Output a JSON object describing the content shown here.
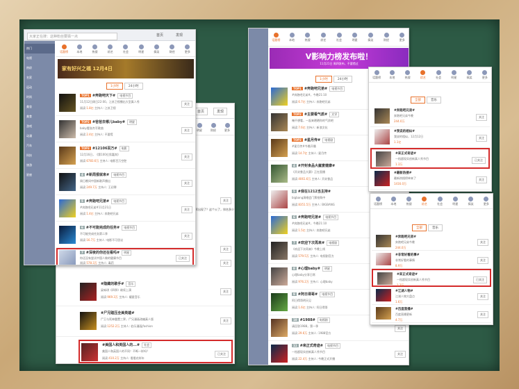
{
  "shot1": {
    "search_placeholder": "大家正在搜：这种粉丝要猜一点",
    "home": "首页",
    "discover": "发现",
    "side": [
      "热门",
      "电视",
      "热综",
      "名家",
      "运动",
      "时尚",
      "美妆",
      "美食",
      "游戏",
      "动漫",
      "汽车",
      "科技",
      "旅游",
      "星座"
    ],
    "icons": [
      "话题榜",
      "本地",
      "热搜",
      "综艺",
      "社会",
      "明星",
      "搞笑",
      "财经",
      "更多"
    ],
    "banner": "家有好兴之福 12月4日",
    "tabs": [
      "1小时",
      "24小时"
    ],
    "rows": [
      {
        "rank": "TOP1",
        "title": "#奔跑吧天下#",
        "tag": "电视节目",
        "desc": "11月12日周日22:00，江苏卫视播出大型真人秀",
        "read": "阅读:",
        "num": "1.8亿",
        "host": "主持人: 江苏卫视"
      },
      {
        "rank": "TOP2",
        "title": "#爸爸去哪儿baby#",
        "tag": "明星",
        "desc": "baby看张杰写歌曲",
        "read": "阅读:",
        "num": "2.4亿",
        "host": "主持人: 不要慌"
      },
      {
        "rank": "TOP3",
        "title": "#12106百万#",
        "tag": "电影",
        "desc": "12月16日，《第100位男嘉宾》",
        "read": "阅读:",
        "num": "6783.6万",
        "host": "主持人: 电影百万空腔"
      },
      {
        "rank": "4",
        "title": "#新周报就来#",
        "tag": "电视节目",
        "desc": "周日晚间中国新歌声播出",
        "read": "阅读:",
        "num": "249.7万",
        "host": "主持人: 王初寒"
      },
      {
        "rank": "5",
        "title": "#奔跑吧兄弟#",
        "tag": "电视节目",
        "desc": "#奔跑吧兄弟#11月21日",
        "read": "阅读:",
        "num": "1.4亿",
        "host": "主持人: 奔跑吧兄弟"
      },
      {
        "rank": "6",
        "title": "#不可能完成的任务#",
        "tag": "电视节目",
        "desc": "不可能完成任务第二季",
        "read": "阅读:",
        "num": "16.7万",
        "host": "主持人: 电影不可思议"
      },
      {
        "rank": "7",
        "title": "#深夜的你还在看吗#",
        "tag": "明星",
        "desc": "你还没有尝试中国人做的健康节目",
        "read": "阅读:",
        "num": "578.3万",
        "host": "主持人: 毒药"
      }
    ],
    "follow": "关注",
    "followed": "已关注"
  },
  "shot2": {
    "home": "首页",
    "discover": "发现",
    "icons": [
      "话题榜",
      "本地",
      "热搜",
      "综艺",
      "社会",
      "明星",
      "搞笑",
      "财经",
      "更多"
    ],
    "line": "冠军出现了？这个火了，排名多少",
    "rows": [
      {
        "title": "#隐藏的歌手#",
        "tag": "音乐",
        "desc": "梁咏琪《四季》继续上演",
        "read": "阅读:",
        "num": "969.3万",
        "host": "主持人: 耀星音乐"
      },
      {
        "title": "#尸兄碰压全美英雄#",
        "tag": "",
        "desc": "尸王与死神重置三界，尸兄漫画改编真人版",
        "read": "阅读:",
        "num": "1252.2万",
        "host": "主持人: 伯乐漫画jfashion"
      },
      {
        "title": "#美国人和英国人的...#",
        "tag": "社会",
        "desc": "美国人和英国人的不同！不断一样吗？",
        "read": "阅读:",
        "num": "410.2万",
        "host": "主持人: 看看花样年"
      }
    ]
  },
  "shot3": {
    "banner": "V影响力榜发布啦！",
    "banner_sub": "11月21日 周四发布，不要错过",
    "icons": [
      "话题榜",
      "本地",
      "热搜",
      "综艺",
      "社会",
      "明星",
      "搞笑",
      "财经",
      "更多"
    ],
    "tabs": [
      "1小时",
      "24小时"
    ],
    "rows": [
      {
        "rank": "TOP1",
        "title": "#奔跑吧兄弟#",
        "tag": "电视节目",
        "desc": "#奔跑吧兄弟#，今晚21:10",
        "read": "阅读:",
        "num": "6.7亿",
        "host": "主持人: 奔跑吧兄弟"
      },
      {
        "rank": "TOP2",
        "title": "#主要看气质#",
        "tag": "文学",
        "desc": "俺不想看，一起来晒晒你的气质吧",
        "read": "阅读:",
        "num": "7.6亿",
        "host": "主持人: 新浪文化"
      },
      {
        "rank": "TOP3",
        "title": "#星月传#",
        "tag": "电视剧",
        "desc": "#星月传#今晚开播",
        "read": "阅读:",
        "num": "14.7亿",
        "host": "主持人: 星月传"
      },
      {
        "rank": "4",
        "title": "#开封食品大酱宴健康#",
        "tag": "",
        "desc": "《开封食品大赛》正在直播",
        "read": "阅读:",
        "num": "4061.6万",
        "host": "主持人: 开封食品"
      },
      {
        "rank": "5",
        "title": "#我在1212当主持#",
        "tag": "",
        "desc": "bigbang演唱会门票抢购中",
        "read": "阅读:",
        "num": "8351.5万",
        "host": "主持人: BIGBANG"
      },
      {
        "rank": "6",
        "title": "#奔跑吧兄弟#",
        "tag": "电视节目",
        "desc": "#奔跑吧兄弟#，今晚21:10",
        "read": "阅读:",
        "num": "1.5亿",
        "host": "主持人: 奔跑吧兄弟"
      },
      {
        "rank": "7",
        "title": "#欢迎下次再来#",
        "tag": "电视剧",
        "desc": "《欢迎下次再来》今晚上线",
        "read": "阅读:",
        "num": "579.5万",
        "host": "主持人: 电视剧官方"
      },
      {
        "rank": "8",
        "title": "#心理baby#",
        "tag": "明星",
        "desc": "心理baby分享日常",
        "read": "阅读:",
        "num": "976.2万",
        "host": "主持人: 心理baby"
      },
      {
        "rank": "9",
        "title": "#阿日得哥#",
        "tag": "电视节目",
        "desc": "阿日得哥明天见",
        "read": "阅读:",
        "num": "1.6亿",
        "host": "主持人: 阿日得哥"
      },
      {
        "rank": "10",
        "title": "#1988#",
        "tag": "电视剧",
        "desc": "请回答1988，第一季",
        "read": "阅读:",
        "num": "29.6万",
        "host": "主持人: 1988官方"
      },
      {
        "rank": "11",
        "title": "#来正式奇迹#",
        "tag": "电视节目",
        "desc": "一档超现实创新真人秀节目",
        "read": "阅读:",
        "num": "22.4万",
        "host": "主持人: 今晚正式开播"
      }
    ],
    "follow": "关注"
  },
  "shot4": {
    "icons": [
      "话题榜",
      "本地",
      "热搜",
      "综艺",
      "社会",
      "明星",
      "搞笑",
      "更多"
    ],
    "tabs": [
      "全部",
      "音乐"
    ],
    "rows": [
      {
        "title": "#奔跑吧兄弟#",
        "desc": "奔跑吧兄弟今晚",
        "num": "244.0万"
      },
      {
        "title": "#我说的相似#",
        "desc": "我说的相似，12月12日",
        "num": "1.1亿"
      },
      {
        "title": "#来正式奇迹#",
        "desc": "一档超现实创新真人秀节目",
        "num": "1.3万"
      },
      {
        "title": "#最新热搜#",
        "desc": "最新热搜榜单来了",
        "num": "1416.0万"
      }
    ],
    "follow": "关注",
    "followed": "已关注"
  },
  "shot5": {
    "icons": [
      "话题榜",
      "本地",
      "热搜",
      "综艺",
      "社会",
      "明星",
      "搞笑",
      "更多"
    ],
    "tabs": [
      "全部",
      "音乐"
    ],
    "rows": [
      {
        "title": "#奔跑吧兄弟#",
        "desc": "奔跑吧兄弟今晚",
        "num": "244.0万"
      },
      {
        "title": "#非常好看的事#",
        "desc": "非常好看的事情",
        "num": "8.9万"
      },
      {
        "title": "#来正式奇迹#",
        "desc": "一档超现实创新真人秀节目",
        "num": "1.3万"
      },
      {
        "title": "#江湖人物#",
        "desc": "江湖人物大盘点",
        "num": "1.6万"
      },
      {
        "title": "#百度直播#",
        "desc": "百度直播更新",
        "num": "4.7万"
      }
    ],
    "follow": "关注",
    "followed": "已关注"
  }
}
